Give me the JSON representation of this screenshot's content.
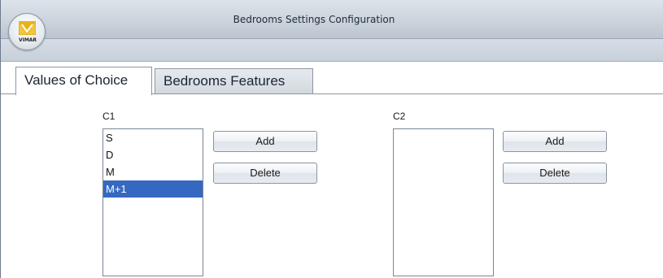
{
  "window": {
    "title": "Bedrooms Settings Configuration"
  },
  "app_button": {
    "logo_text": "VIMAR",
    "icon": "vimar-logo-icon"
  },
  "tabs": [
    {
      "label": "Values of Choice",
      "active": true
    },
    {
      "label": "Bedrooms Features",
      "active": false
    }
  ],
  "groups": [
    {
      "label": "C1",
      "items": [
        {
          "text": "S",
          "selected": false
        },
        {
          "text": "D",
          "selected": false
        },
        {
          "text": "M",
          "selected": false
        },
        {
          "text": "M+1",
          "selected": true
        }
      ],
      "add_label": "Add",
      "delete_label": "Delete"
    },
    {
      "label": "C2",
      "items": [],
      "add_label": "Add",
      "delete_label": "Delete"
    }
  ],
  "colors": {
    "selection": "#3569c1",
    "logo_yellow": "#e9b21c"
  }
}
